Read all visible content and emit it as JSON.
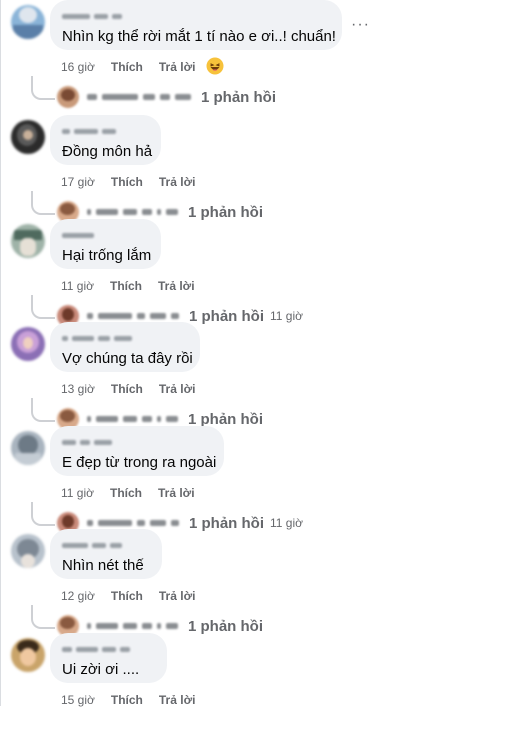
{
  "labels": {
    "like": "Thích",
    "reply": "Trả lời",
    "more": "···"
  },
  "comments": [
    {
      "text": "Nhìn kg thể rời mắt 1 tí nào e ơi..! chuẩn!",
      "time": "16 giờ",
      "replies": "1 phản hồi",
      "reply_time": ""
    },
    {
      "text": "Đồng môn hả",
      "time": "17 giờ",
      "replies": "1 phản hồi",
      "reply_time": ""
    },
    {
      "text": "Hại trống lắm",
      "time": "11 giờ",
      "replies": "1 phản hồi",
      "reply_time": "11 giờ"
    },
    {
      "text": "Vợ chúng ta đây rồi",
      "time": "13 giờ",
      "replies": "1 phản hồi",
      "reply_time": ""
    },
    {
      "text": "E đẹp từ trong ra ngoài",
      "time": "11 giờ",
      "replies": "1 phản hồi",
      "reply_time": "11 giờ"
    },
    {
      "text": "Nhìn nét thế",
      "time": "12 giờ",
      "replies": "1 phản hồi",
      "reply_time": ""
    },
    {
      "text": "Ui zời ơi ....",
      "time": "15 giờ",
      "replies": "",
      "reply_time": ""
    }
  ],
  "emoji_icon": "laughing-face-icon",
  "colors": {
    "bubble": "#f0f2f5",
    "meta_text": "#65676b",
    "text": "#050505"
  }
}
